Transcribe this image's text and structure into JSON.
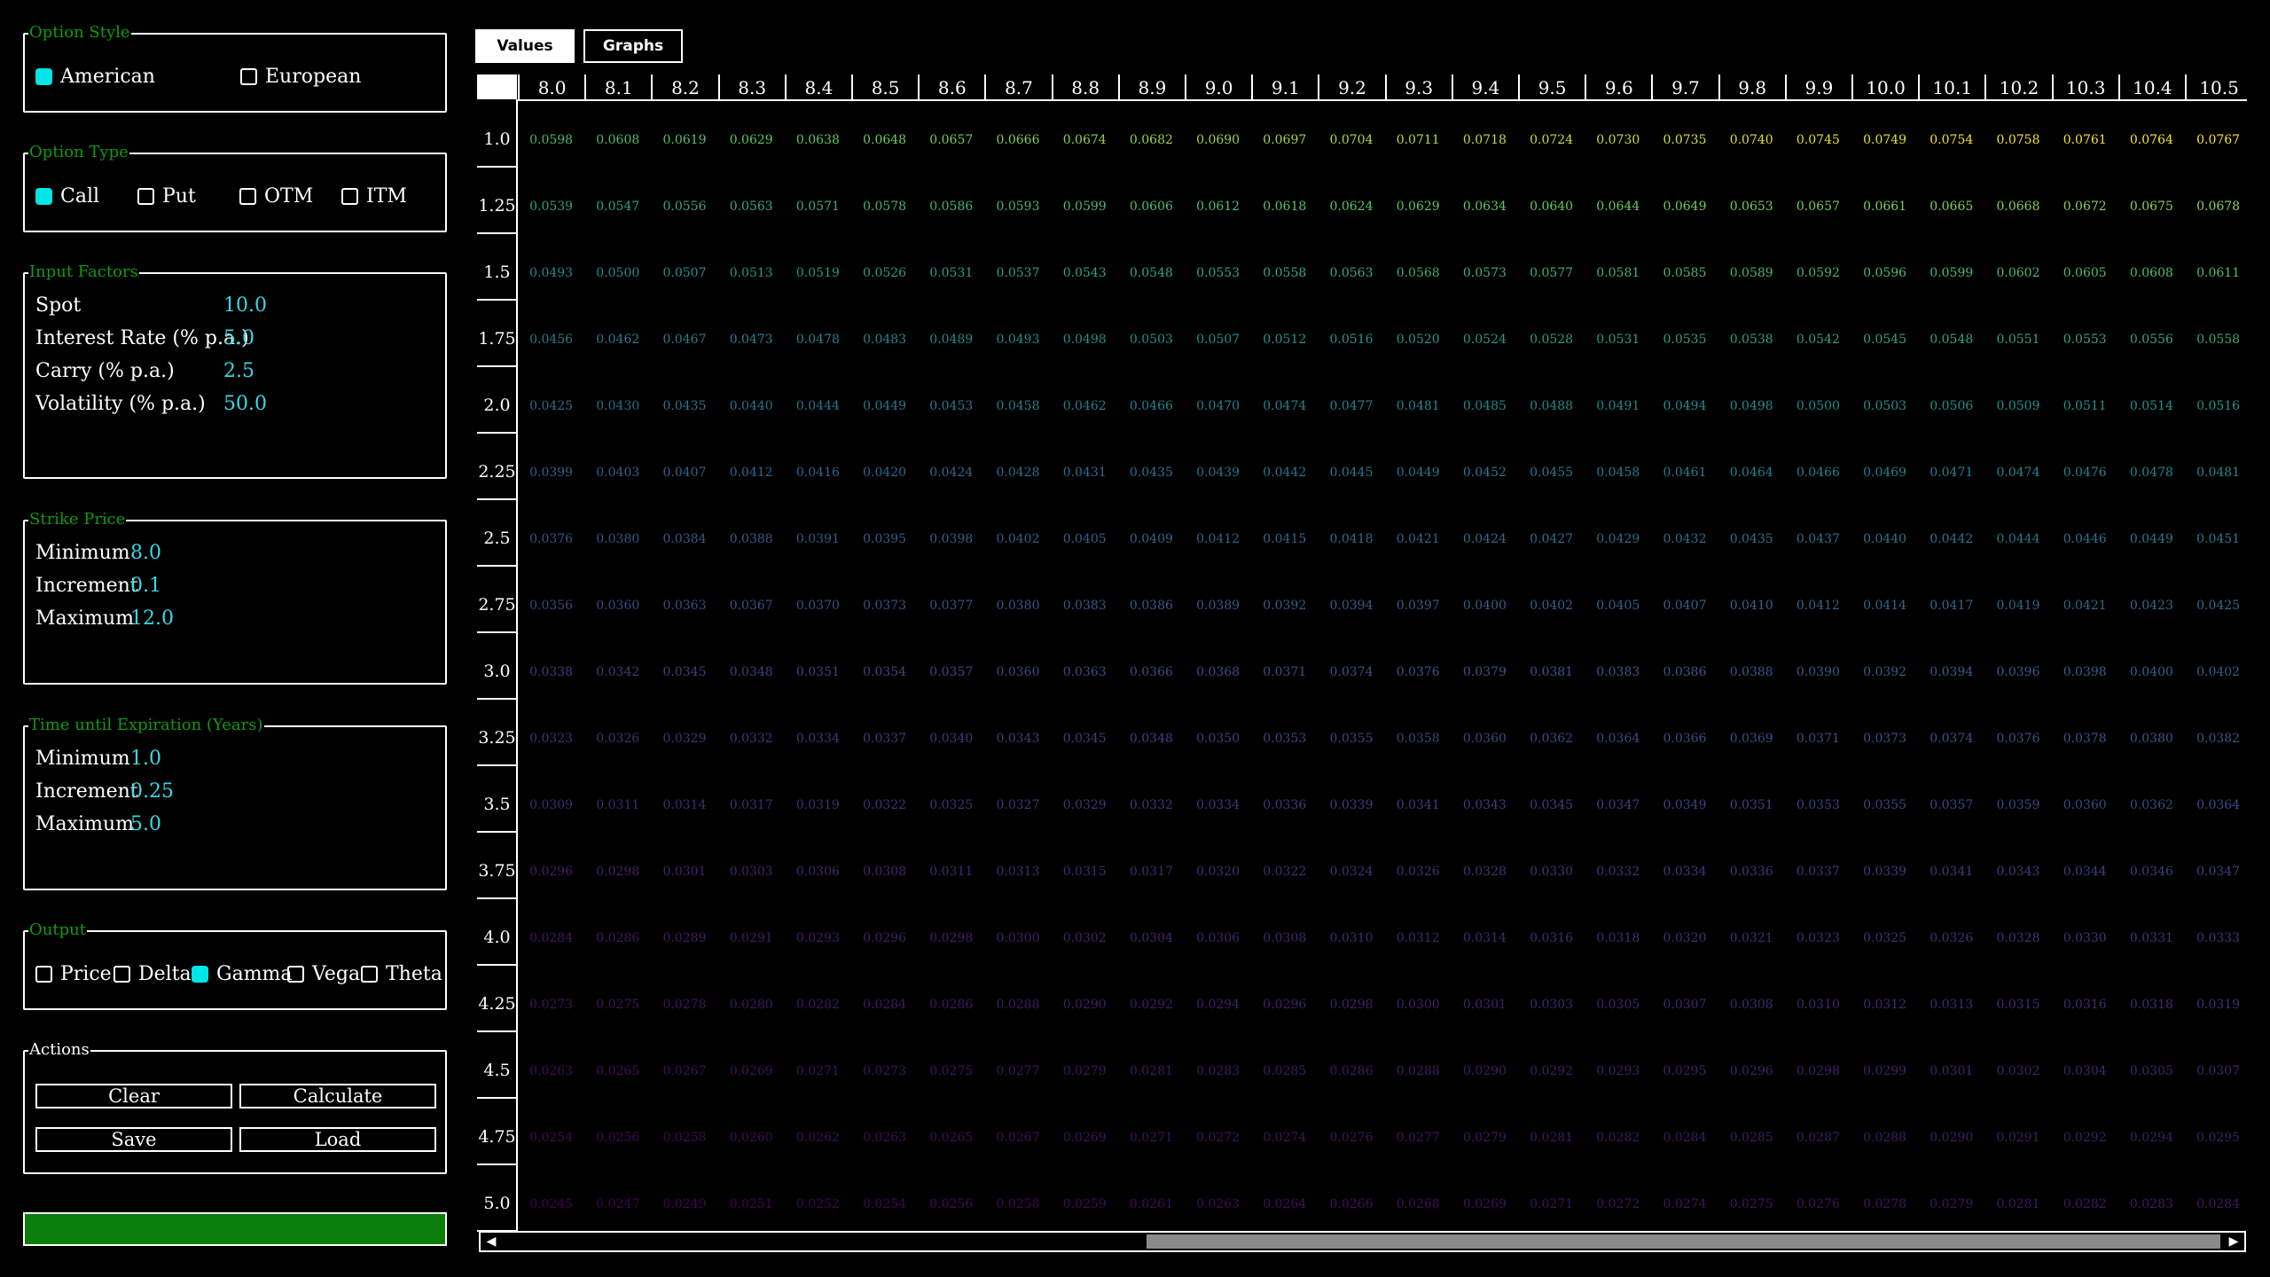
{
  "option_style": {
    "legend": "Option Style",
    "options": [
      {
        "label": "American",
        "checked": true
      },
      {
        "label": "European",
        "checked": false
      }
    ]
  },
  "option_type": {
    "legend": "Option Type",
    "options": [
      {
        "label": "Call",
        "checked": true
      },
      {
        "label": "Put",
        "checked": false
      },
      {
        "label": "OTM",
        "checked": false
      },
      {
        "label": "ITM",
        "checked": false
      }
    ]
  },
  "input_factors": {
    "legend": "Input Factors",
    "rows": [
      {
        "label": "Spot",
        "value": "10.0"
      },
      {
        "label": "Interest Rate (% p.a.)",
        "value": "5.0"
      },
      {
        "label": "Carry (% p.a.)",
        "value": "2.5"
      },
      {
        "label": "Volatility (% p.a.)",
        "value": "50.0"
      }
    ]
  },
  "strike_price": {
    "legend": "Strike Price",
    "rows": [
      {
        "label": "Minimum",
        "value": "8.0"
      },
      {
        "label": "Increment",
        "value": "0.1"
      },
      {
        "label": "Maximum",
        "value": "12.0"
      }
    ]
  },
  "time_expiration": {
    "legend": "Time until Expiration (Years)",
    "rows": [
      {
        "label": "Minimum",
        "value": "1.0"
      },
      {
        "label": "Increment",
        "value": "0.25"
      },
      {
        "label": "Maximum",
        "value": "5.0"
      }
    ]
  },
  "output": {
    "legend": "Output",
    "options": [
      {
        "label": "Price",
        "checked": false
      },
      {
        "label": "Delta",
        "checked": false
      },
      {
        "label": "Gamma",
        "checked": true
      },
      {
        "label": "Vega",
        "checked": false
      },
      {
        "label": "Theta",
        "checked": false
      }
    ]
  },
  "actions": {
    "legend": "Actions",
    "clear": "Clear",
    "calculate": "Calculate",
    "save": "Save",
    "load": "Load"
  },
  "progress": {
    "fraction": 1.0
  },
  "tabs": [
    {
      "label": "Values",
      "active": true
    },
    {
      "label": "Graphs",
      "active": false
    }
  ],
  "colors": {
    "legend_green": "#0f9b0f",
    "value_cyan": "#3ad7e6",
    "check_cyan": "#00e5e5",
    "cell_scale": [
      "#440154",
      "#3b528b",
      "#21918c",
      "#5ec962",
      "#fde725"
    ]
  },
  "scrollbar": {
    "thumb_start_fraction": 0.375,
    "thumb_end_fraction": 1.0,
    "left_arrow": "◀",
    "right_arrow": "▶"
  },
  "table": {
    "columns": [
      "8.0",
      "8.1",
      "8.2",
      "8.3",
      "8.4",
      "8.5",
      "8.6",
      "8.7",
      "8.8",
      "8.9",
      "9.0",
      "9.1",
      "9.2",
      "9.3",
      "9.4",
      "9.5",
      "9.6",
      "9.7",
      "9.8",
      "9.9",
      "10.0",
      "10.1",
      "10.2",
      "10.3",
      "10.4",
      "10.5"
    ],
    "rows": [
      {
        "label": "1.0",
        "values": [
          "0.0598",
          "0.0608",
          "0.0619",
          "0.0629",
          "0.0638",
          "0.0648",
          "0.0657",
          "0.0666",
          "0.0674",
          "0.0682",
          "0.0690",
          "0.0697",
          "0.0704",
          "0.0711",
          "0.0718",
          "0.0724",
          "0.0730",
          "0.0735",
          "0.0740",
          "0.0745",
          "0.0749",
          "0.0754",
          "0.0758",
          "0.0761",
          "0.0764",
          "0.0767"
        ]
      },
      {
        "label": "1.25",
        "values": [
          "0.0539",
          "0.0547",
          "0.0556",
          "0.0563",
          "0.0571",
          "0.0578",
          "0.0586",
          "0.0593",
          "0.0599",
          "0.0606",
          "0.0612",
          "0.0618",
          "0.0624",
          "0.0629",
          "0.0634",
          "0.0640",
          "0.0644",
          "0.0649",
          "0.0653",
          "0.0657",
          "0.0661",
          "0.0665",
          "0.0668",
          "0.0672",
          "0.0675",
          "0.0678"
        ]
      },
      {
        "label": "1.5",
        "values": [
          "0.0493",
          "0.0500",
          "0.0507",
          "0.0513",
          "0.0519",
          "0.0526",
          "0.0531",
          "0.0537",
          "0.0543",
          "0.0548",
          "0.0553",
          "0.0558",
          "0.0563",
          "0.0568",
          "0.0573",
          "0.0577",
          "0.0581",
          "0.0585",
          "0.0589",
          "0.0592",
          "0.0596",
          "0.0599",
          "0.0602",
          "0.0605",
          "0.0608",
          "0.0611"
        ]
      },
      {
        "label": "1.75",
        "values": [
          "0.0456",
          "0.0462",
          "0.0467",
          "0.0473",
          "0.0478",
          "0.0483",
          "0.0489",
          "0.0493",
          "0.0498",
          "0.0503",
          "0.0507",
          "0.0512",
          "0.0516",
          "0.0520",
          "0.0524",
          "0.0528",
          "0.0531",
          "0.0535",
          "0.0538",
          "0.0542",
          "0.0545",
          "0.0548",
          "0.0551",
          "0.0553",
          "0.0556",
          "0.0558"
        ]
      },
      {
        "label": "2.0",
        "values": [
          "0.0425",
          "0.0430",
          "0.0435",
          "0.0440",
          "0.0444",
          "0.0449",
          "0.0453",
          "0.0458",
          "0.0462",
          "0.0466",
          "0.0470",
          "0.0474",
          "0.0477",
          "0.0481",
          "0.0485",
          "0.0488",
          "0.0491",
          "0.0494",
          "0.0498",
          "0.0500",
          "0.0503",
          "0.0506",
          "0.0509",
          "0.0511",
          "0.0514",
          "0.0516"
        ]
      },
      {
        "label": "2.25",
        "values": [
          "0.0399",
          "0.0403",
          "0.0407",
          "0.0412",
          "0.0416",
          "0.0420",
          "0.0424",
          "0.0428",
          "0.0431",
          "0.0435",
          "0.0439",
          "0.0442",
          "0.0445",
          "0.0449",
          "0.0452",
          "0.0455",
          "0.0458",
          "0.0461",
          "0.0464",
          "0.0466",
          "0.0469",
          "0.0471",
          "0.0474",
          "0.0476",
          "0.0478",
          "0.0481"
        ]
      },
      {
        "label": "2.5",
        "values": [
          "0.0376",
          "0.0380",
          "0.0384",
          "0.0388",
          "0.0391",
          "0.0395",
          "0.0398",
          "0.0402",
          "0.0405",
          "0.0409",
          "0.0412",
          "0.0415",
          "0.0418",
          "0.0421",
          "0.0424",
          "0.0427",
          "0.0429",
          "0.0432",
          "0.0435",
          "0.0437",
          "0.0440",
          "0.0442",
          "0.0444",
          "0.0446",
          "0.0449",
          "0.0451"
        ]
      },
      {
        "label": "2.75",
        "values": [
          "0.0356",
          "0.0360",
          "0.0363",
          "0.0367",
          "0.0370",
          "0.0373",
          "0.0377",
          "0.0380",
          "0.0383",
          "0.0386",
          "0.0389",
          "0.0392",
          "0.0394",
          "0.0397",
          "0.0400",
          "0.0402",
          "0.0405",
          "0.0407",
          "0.0410",
          "0.0412",
          "0.0414",
          "0.0417",
          "0.0419",
          "0.0421",
          "0.0423",
          "0.0425"
        ]
      },
      {
        "label": "3.0",
        "values": [
          "0.0338",
          "0.0342",
          "0.0345",
          "0.0348",
          "0.0351",
          "0.0354",
          "0.0357",
          "0.0360",
          "0.0363",
          "0.0366",
          "0.0368",
          "0.0371",
          "0.0374",
          "0.0376",
          "0.0379",
          "0.0381",
          "0.0383",
          "0.0386",
          "0.0388",
          "0.0390",
          "0.0392",
          "0.0394",
          "0.0396",
          "0.0398",
          "0.0400",
          "0.0402"
        ]
      },
      {
        "label": "3.25",
        "values": [
          "0.0323",
          "0.0326",
          "0.0329",
          "0.0332",
          "0.0334",
          "0.0337",
          "0.0340",
          "0.0343",
          "0.0345",
          "0.0348",
          "0.0350",
          "0.0353",
          "0.0355",
          "0.0358",
          "0.0360",
          "0.0362",
          "0.0364",
          "0.0366",
          "0.0369",
          "0.0371",
          "0.0373",
          "0.0374",
          "0.0376",
          "0.0378",
          "0.0380",
          "0.0382"
        ]
      },
      {
        "label": "3.5",
        "values": [
          "0.0309",
          "0.0311",
          "0.0314",
          "0.0317",
          "0.0319",
          "0.0322",
          "0.0325",
          "0.0327",
          "0.0329",
          "0.0332",
          "0.0334",
          "0.0336",
          "0.0339",
          "0.0341",
          "0.0343",
          "0.0345",
          "0.0347",
          "0.0349",
          "0.0351",
          "0.0353",
          "0.0355",
          "0.0357",
          "0.0359",
          "0.0360",
          "0.0362",
          "0.0364"
        ]
      },
      {
        "label": "3.75",
        "values": [
          "0.0296",
          "0.0298",
          "0.0301",
          "0.0303",
          "0.0306",
          "0.0308",
          "0.0311",
          "0.0313",
          "0.0315",
          "0.0317",
          "0.0320",
          "0.0322",
          "0.0324",
          "0.0326",
          "0.0328",
          "0.0330",
          "0.0332",
          "0.0334",
          "0.0336",
          "0.0337",
          "0.0339",
          "0.0341",
          "0.0343",
          "0.0344",
          "0.0346",
          "0.0347"
        ]
      },
      {
        "label": "4.0",
        "values": [
          "0.0284",
          "0.0286",
          "0.0289",
          "0.0291",
          "0.0293",
          "0.0296",
          "0.0298",
          "0.0300",
          "0.0302",
          "0.0304",
          "0.0306",
          "0.0308",
          "0.0310",
          "0.0312",
          "0.0314",
          "0.0316",
          "0.0318",
          "0.0320",
          "0.0321",
          "0.0323",
          "0.0325",
          "0.0326",
          "0.0328",
          "0.0330",
          "0.0331",
          "0.0333"
        ]
      },
      {
        "label": "4.25",
        "values": [
          "0.0273",
          "0.0275",
          "0.0278",
          "0.0280",
          "0.0282",
          "0.0284",
          "0.0286",
          "0.0288",
          "0.0290",
          "0.0292",
          "0.0294",
          "0.0296",
          "0.0298",
          "0.0300",
          "0.0301",
          "0.0303",
          "0.0305",
          "0.0307",
          "0.0308",
          "0.0310",
          "0.0312",
          "0.0313",
          "0.0315",
          "0.0316",
          "0.0318",
          "0.0319"
        ]
      },
      {
        "label": "4.5",
        "values": [
          "0.0263",
          "0.0265",
          "0.0267",
          "0.0269",
          "0.0271",
          "0.0273",
          "0.0275",
          "0.0277",
          "0.0279",
          "0.0281",
          "0.0283",
          "0.0285",
          "0.0286",
          "0.0288",
          "0.0290",
          "0.0292",
          "0.0293",
          "0.0295",
          "0.0296",
          "0.0298",
          "0.0299",
          "0.0301",
          "0.0302",
          "0.0304",
          "0.0305",
          "0.0307"
        ]
      },
      {
        "label": "4.75",
        "values": [
          "0.0254",
          "0.0256",
          "0.0258",
          "0.0260",
          "0.0262",
          "0.0263",
          "0.0265",
          "0.0267",
          "0.0269",
          "0.0271",
          "0.0272",
          "0.0274",
          "0.0276",
          "0.0277",
          "0.0279",
          "0.0281",
          "0.0282",
          "0.0284",
          "0.0285",
          "0.0287",
          "0.0288",
          "0.0290",
          "0.0291",
          "0.0292",
          "0.0294",
          "0.0295"
        ]
      },
      {
        "label": "5.0",
        "values": [
          "0.0245",
          "0.0247",
          "0.0249",
          "0.0251",
          "0.0252",
          "0.0254",
          "0.0256",
          "0.0258",
          "0.0259",
          "0.0261",
          "0.0263",
          "0.0264",
          "0.0266",
          "0.0268",
          "0.0269",
          "0.0271",
          "0.0272",
          "0.0274",
          "0.0275",
          "0.0276",
          "0.0278",
          "0.0279",
          "0.0281",
          "0.0282",
          "0.0283",
          "0.0284"
        ]
      }
    ]
  }
}
